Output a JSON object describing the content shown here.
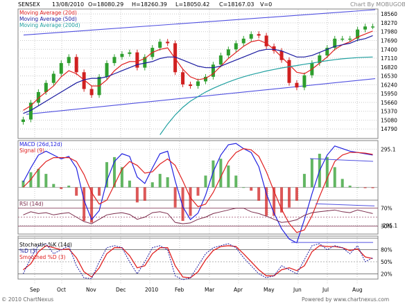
{
  "header": {
    "symbol": "SENSEX",
    "date": "13/08/2010",
    "open": "O=18080.29",
    "high": "H=18260.39",
    "low": "L=18050.42",
    "close": "C=18167.03",
    "volume": "V=0",
    "credit": "Chart By MOBUGOBU"
  },
  "footer": {
    "copyright": "© 2010 ChartNexus",
    "powered": "Powered by www.chartnexus.com"
  },
  "colors": {
    "up": "#2e9e2e",
    "down": "#d02020",
    "ma20": "#e02020",
    "ma50": "#1a1aa0",
    "ma200": "#20a0a0",
    "channel": "#5050e0",
    "macd": "#2020e0",
    "signal": "#e02020",
    "rsi": "#7a2a4a",
    "grid": "#c8c8c8",
    "frame": "#808080"
  },
  "chart_data": [
    {
      "type": "candlestick",
      "title": "",
      "legend": [
        "Moving Average (20d)",
        "Moving Average (50d)",
        "Moving Average (200d)"
      ],
      "y_ticks": [
        18560,
        18270,
        17980,
        17690,
        17400,
        17110,
        16820,
        16530,
        16240,
        15950,
        15660,
        15370,
        15080,
        14790
      ],
      "x_labels": [
        "Sep",
        "Oct",
        "Nov",
        "Dec",
        "2010",
        "Feb",
        "Mar",
        "Apr",
        "May",
        "Jun",
        "Jul",
        "Aug"
      ],
      "ylim": [
        14500,
        18700
      ],
      "series": [
        {
          "name": "Close",
          "values": [
            15100,
            15650,
            16000,
            16300,
            16600,
            16950,
            17150,
            16650,
            16100,
            15900,
            16500,
            16950,
            17150,
            17250,
            17300,
            16800,
            17150,
            17450,
            17650,
            17600,
            16650,
            16250,
            16200,
            16350,
            16500,
            16900,
            17200,
            17400,
            17600,
            17750,
            17900,
            17850,
            17500,
            17350,
            17050,
            16300,
            16150,
            16550,
            16950,
            17200,
            17450,
            17750,
            17750,
            17750,
            18050,
            18150,
            18150
          ]
        },
        {
          "name": "Moving Average (20d)",
          "values": [
            15400,
            15550,
            15800,
            16000,
            16200,
            16500,
            16700,
            16600,
            16400,
            16200,
            16200,
            16400,
            16700,
            16900,
            17000,
            17000,
            17100,
            17300,
            17400,
            17450,
            17100,
            16750,
            16500,
            16400,
            16450,
            16600,
            16850,
            17100,
            17300,
            17500,
            17650,
            17700,
            17600,
            17400,
            17150,
            16900,
            16650,
            16600,
            16750,
            16950,
            17150,
            17400,
            17550,
            17650,
            17800,
            17900,
            18000
          ]
        },
        {
          "name": "Moving Average (50d)",
          "values": [
            15300,
            15400,
            15550,
            15700,
            15850,
            16000,
            16150,
            16300,
            16400,
            16450,
            16450,
            16500,
            16600,
            16700,
            16800,
            16900,
            16950,
            17000,
            17100,
            17150,
            17150,
            17050,
            16950,
            16850,
            16800,
            16800,
            16850,
            16950,
            17050,
            17150,
            17250,
            17350,
            17400,
            17400,
            17350,
            17250,
            17150,
            17150,
            17200,
            17300,
            17400,
            17500,
            17550,
            17600,
            17700,
            17750,
            17850
          ]
        },
        {
          "name": "Moving Average (200d)",
          "values": [
            null,
            null,
            null,
            null,
            null,
            null,
            null,
            null,
            null,
            null,
            null,
            null,
            null,
            null,
            null,
            null,
            null,
            null,
            14600,
            14950,
            15250,
            15500,
            15700,
            15850,
            16000,
            16120,
            16230,
            16330,
            16420,
            16500,
            16570,
            16630,
            16690,
            16740,
            16790,
            16830,
            16870,
            16910,
            16950,
            16990,
            17030,
            17060,
            17090,
            17110,
            17130,
            17140,
            17150
          ]
        }
      ],
      "annotations": "upper and lower trend channel lines"
    },
    {
      "type": "line",
      "legend": [
        "MACD (26d,12d)",
        "Signal (9)"
      ],
      "y_ticks": [
        295.1,
        -295.1
      ],
      "series": [
        {
          "name": "MACD (26d,12d)",
          "values": [
            40,
            150,
            250,
            280,
            250,
            220,
            240,
            150,
            -100,
            -250,
            -180,
            50,
            200,
            260,
            240,
            80,
            30,
            150,
            260,
            280,
            50,
            -150,
            -250,
            -200,
            -60,
            120,
            250,
            330,
            340,
            300,
            270,
            160,
            -50,
            -200,
            -320,
            -400,
            -430,
            -250,
            -50,
            130,
            250,
            320,
            300,
            280,
            270,
            260,
            250
          ]
        },
        {
          "name": "Signal (9)",
          "values": [
            0,
            60,
            140,
            200,
            230,
            230,
            230,
            200,
            100,
            -40,
            -130,
            -100,
            20,
            140,
            200,
            170,
            110,
            120,
            180,
            220,
            170,
            50,
            -80,
            -150,
            -130,
            -40,
            80,
            200,
            270,
            300,
            290,
            240,
            120,
            -30,
            -170,
            -280,
            -350,
            -330,
            -220,
            -70,
            70,
            200,
            250,
            270,
            270,
            265,
            255
          ]
        }
      ]
    },
    {
      "type": "line",
      "legend": [
        "RSI (14d)"
      ],
      "y_ticks": [
        "70%",
        "30%"
      ],
      "series": [
        {
          "name": "RSI (14d)",
          "values": [
            55,
            62,
            58,
            60,
            55,
            58,
            60,
            50,
            40,
            35,
            45,
            55,
            58,
            60,
            56,
            45,
            50,
            60,
            62,
            58,
            38,
            35,
            37,
            45,
            50,
            58,
            62,
            66,
            70,
            70,
            62,
            58,
            52,
            45,
            38,
            40,
            44,
            54,
            60,
            62,
            64,
            66,
            62,
            60,
            66,
            62,
            58
          ]
        }
      ]
    },
    {
      "type": "line",
      "legend": [
        "Stochastic %K (14d)",
        "%D (3)",
        "Smoothed %D (3)"
      ],
      "y_ticks": [
        "80%",
        "50%",
        "20%"
      ],
      "series": [
        {
          "name": "Stochastic %K (14d)",
          "values": [
            20,
            60,
            90,
            95,
            70,
            80,
            90,
            40,
            10,
            8,
            50,
            85,
            90,
            85,
            50,
            20,
            50,
            85,
            90,
            80,
            15,
            5,
            10,
            40,
            70,
            85,
            90,
            95,
            85,
            60,
            40,
            20,
            10,
            15,
            40,
            30,
            20,
            55,
            90,
            95,
            80,
            90,
            85,
            70,
            90,
            50,
            60
          ]
        },
        {
          "name": "Smoothed %D (3)",
          "values": [
            30,
            45,
            75,
            90,
            85,
            80,
            82,
            60,
            25,
            12,
            35,
            70,
            85,
            85,
            65,
            35,
            40,
            70,
            85,
            85,
            40,
            12,
            10,
            25,
            55,
            78,
            88,
            90,
            88,
            70,
            50,
            30,
            15,
            15,
            30,
            35,
            28,
            40,
            75,
            90,
            88,
            88,
            85,
            78,
            82,
            62,
            58
          ]
        }
      ]
    }
  ]
}
